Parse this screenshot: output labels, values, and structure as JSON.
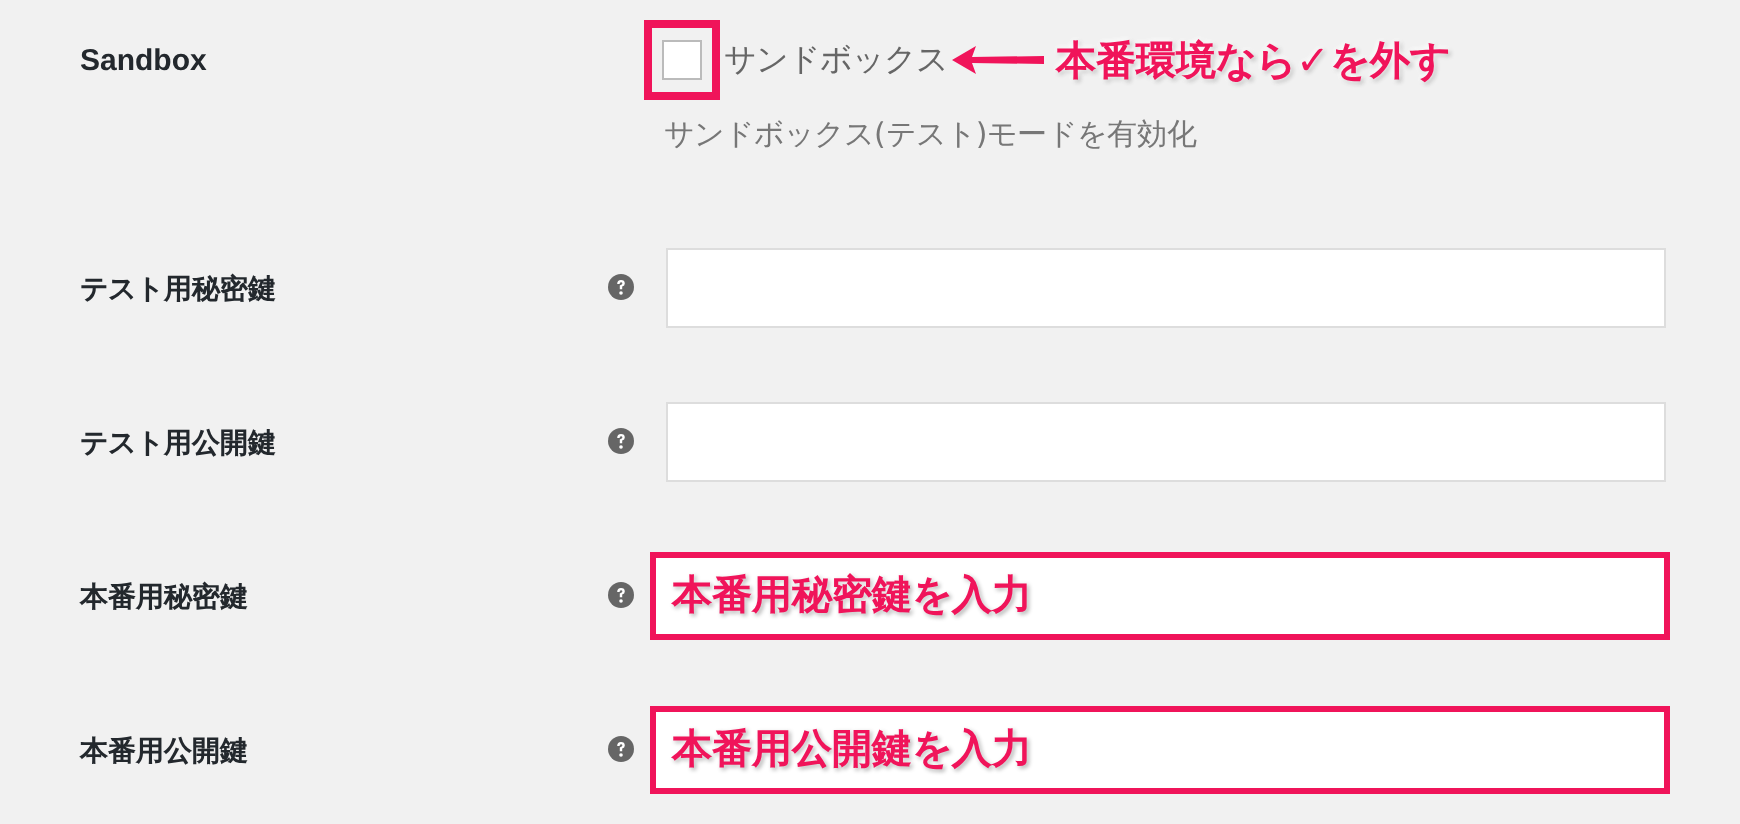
{
  "sandbox": {
    "label": "Sandbox",
    "checked": false,
    "highlighted": true,
    "checkbox_label": "サンドボックス",
    "annotation": "本番環境なら✓を外す",
    "description": "サンドボックス(テスト)モードを有効化"
  },
  "keys": [
    {
      "label": "テスト用秘密鍵",
      "highlighted": false
    },
    {
      "label": "テスト用公開鍵",
      "highlighted": false
    },
    {
      "label": "本番用秘密鍵",
      "highlighted": true,
      "annotation": "本番用秘密鍵を入力"
    },
    {
      "label": "本番用公開鍵",
      "highlighted": true,
      "annotation": "本番用公開鍵を入力"
    }
  ]
}
